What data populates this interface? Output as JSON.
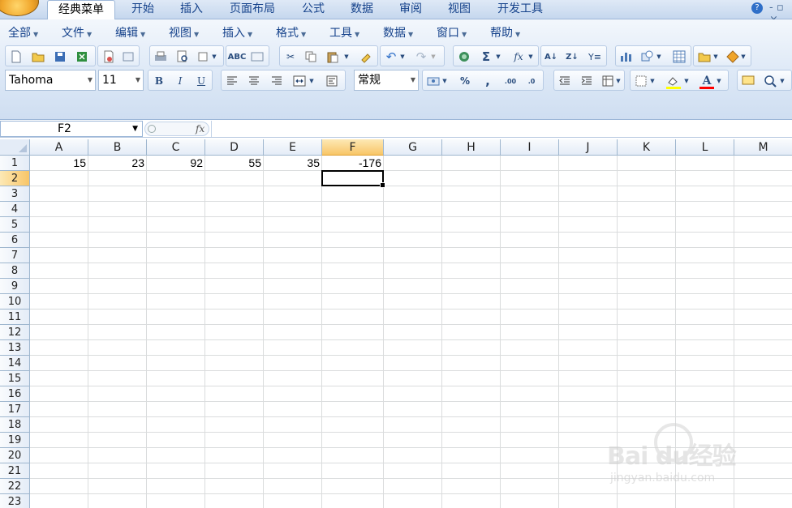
{
  "ribbon_tabs": [
    "经典菜单",
    "开始",
    "插入",
    "页面布局",
    "公式",
    "数据",
    "审阅",
    "视图",
    "开发工具"
  ],
  "active_tab": "经典菜单",
  "help_icon": "?",
  "window_controls": "- ▫ ×",
  "classic_menu": [
    "全部",
    "文件",
    "编辑",
    "视图",
    "插入",
    "格式",
    "工具",
    "数据",
    "窗口",
    "帮助"
  ],
  "format_bar": {
    "font_name": "Tahoma",
    "font_size": "11",
    "bold": "B",
    "italic": "I",
    "underline": "U",
    "number_format": "常规",
    "percent": "%",
    "comma": ",",
    "fill_color": "#ffff00",
    "font_color": "#ff0000"
  },
  "formula_bar": {
    "name_box": "F2",
    "fx": "fx",
    "content": ""
  },
  "columns": [
    "A",
    "B",
    "C",
    "D",
    "E",
    "F",
    "G",
    "H",
    "I",
    "J",
    "K",
    "L",
    "M"
  ],
  "rows": [
    "1",
    "2",
    "3",
    "4",
    "5",
    "6",
    "7",
    "8",
    "9",
    "10",
    "11",
    "12",
    "13",
    "14",
    "15",
    "16",
    "17",
    "18",
    "19",
    "20",
    "21",
    "22",
    "23"
  ],
  "selected_cell": {
    "col": "F",
    "row": "2"
  },
  "cells": {
    "A1": "15",
    "B1": "23",
    "C1": "92",
    "D1": "55",
    "E1": "35",
    "F1": "-176"
  },
  "watermark": {
    "brand": "Bai  du经验",
    "url": "jingyan.baidu.com"
  }
}
